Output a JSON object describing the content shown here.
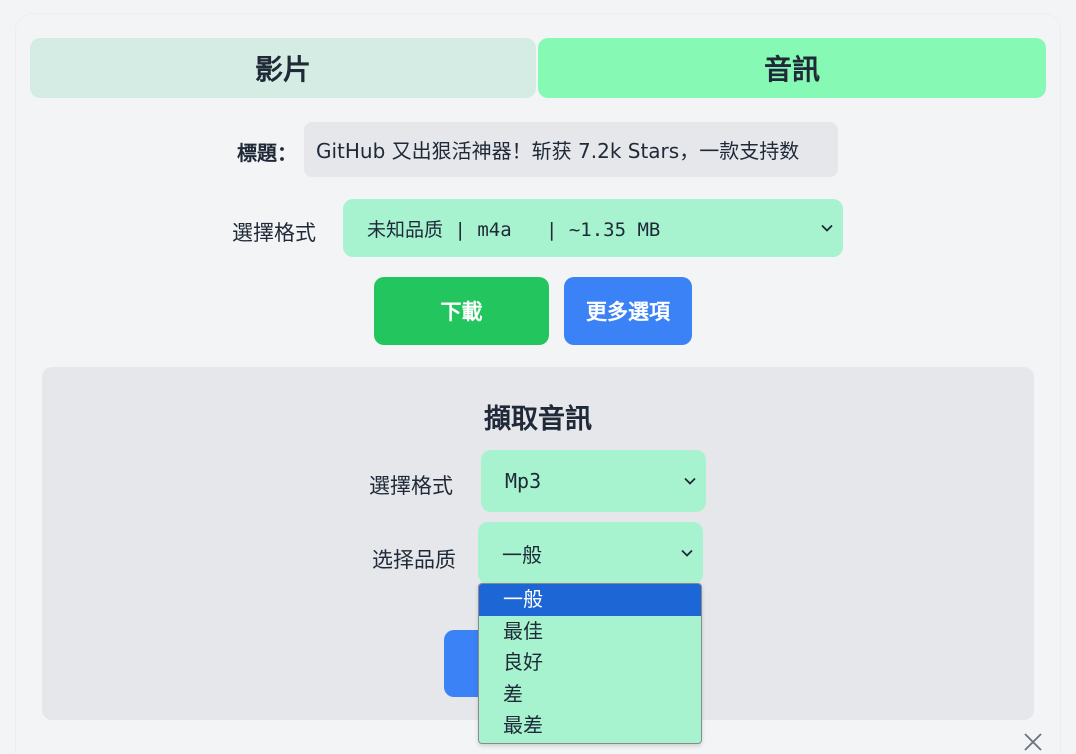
{
  "tabs": {
    "video": "影片",
    "audio": "音訊"
  },
  "title_row": {
    "label": "標題：",
    "value": "GitHub 又出狠活神器！斩获 7.2k Stars，一款支持数"
  },
  "format_row": {
    "label": "選擇格式",
    "selected": "未知品质 | m4a   | ~1.35 MB"
  },
  "buttons": {
    "download": "下載",
    "more_options": "更多選項"
  },
  "extract_panel": {
    "title": "擷取音訊",
    "format_label": "選擇格式",
    "format_value": "Mp3",
    "quality_label": "选择品质",
    "quality_value": "一般",
    "quality_options": [
      "一般",
      "最佳",
      "良好",
      "差",
      "最差"
    ],
    "quality_highlighted_index": 0
  },
  "icons": {
    "dropdown_chevron": "chevron-down-icon",
    "close": "close-icon"
  },
  "colors": {
    "tab_active": "#86f9b5",
    "tab_inactive": "#d5ece4",
    "select_bg": "#a7f3d0",
    "download_btn": "#22c55e",
    "more_btn": "#3b82f6",
    "option_highlight": "#1d66d6"
  }
}
